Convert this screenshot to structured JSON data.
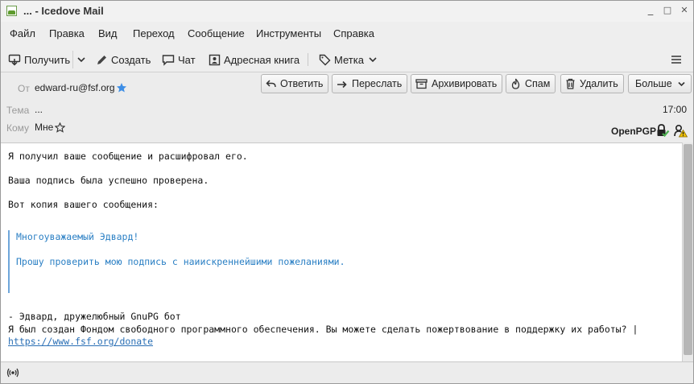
{
  "window": {
    "title": "... - Icedove Mail",
    "minimize": "_",
    "maximize": "□",
    "close": "✕"
  },
  "menu": [
    "Файл",
    "Правка",
    "Вид",
    "Переход",
    "Сообщение",
    "Инструменты",
    "Справка"
  ],
  "toolbar": {
    "get_label": "Получить",
    "compose_label": "Создать",
    "chat_label": "Чат",
    "addressbook_label": "Адресная книга",
    "tag_label": "Метка"
  },
  "header": {
    "from_label": "От",
    "from_value": "edward-ru@fsf.org",
    "subject_label": "Тема",
    "subject_value": "...",
    "to_label": "Кому",
    "to_value": "Мне",
    "time": "17:00",
    "openpgp": "OpenPGP",
    "actions": {
      "reply": "Ответить",
      "forward": "Переслать",
      "archive": "Архивировать",
      "junk": "Спам",
      "delete": "Удалить",
      "more": "Больше"
    }
  },
  "message": {
    "line1": "Я получил ваше сообщение и расшифровал его.",
    "line2": "Ваша подпись была успешно проверена.",
    "line3": "Вот копия вашего сообщения:",
    "quote1": "Многоуважаемый Эдвард!",
    "quote2": "Прошу проверить мою подпись с наиискреннейшими пожеланиями.",
    "sig1": "- Эдвард, дружелюбный GnuPG бот",
    "sig2": "Я был создан Фондом свободного программного обеспечения. Вы можете сделать пожертвование в поддержку их работы? |",
    "link": "https://www.fsf.org/donate"
  },
  "colors": {
    "accent_blue": "#2a7fc4",
    "star_blue": "#3d8ee6",
    "signature_green": "#4caf50",
    "warning_yellow": "#f2c200"
  }
}
